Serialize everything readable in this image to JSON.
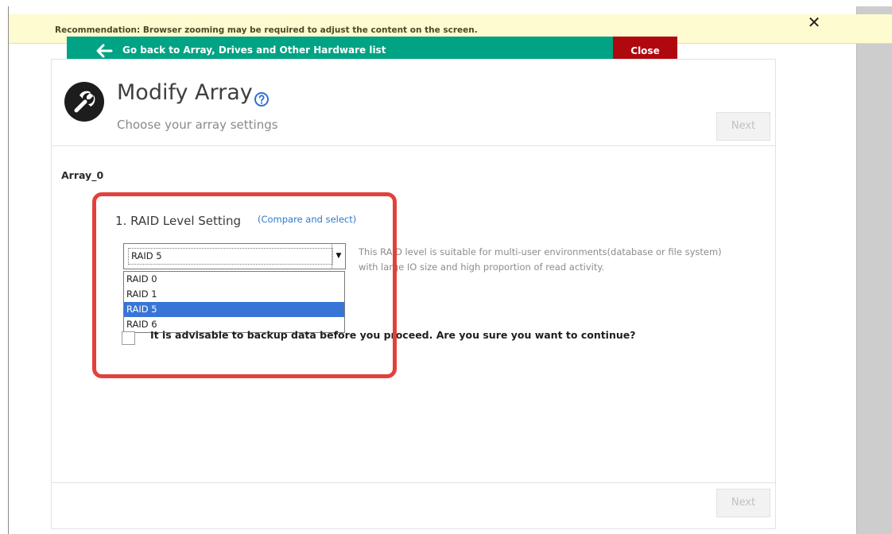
{
  "banner": {
    "text": "Recommendation: Browser zooming may be required to adjust the content on the screen.",
    "close_glyph": "✕"
  },
  "nav": {
    "back_label": "Go back to Array, Drives and Other Hardware list",
    "close_label": "Close"
  },
  "header": {
    "title": "Modify Array",
    "subtitle": "Choose your array settings",
    "next_label": "Next"
  },
  "array": {
    "name": "Array_0"
  },
  "raid": {
    "heading": "1. RAID Level Setting",
    "compare_link": "(Compare and select)",
    "selected_value": "RAID 5",
    "options": [
      "RAID 0",
      "RAID 1",
      "RAID 5",
      "RAID 6"
    ],
    "selected_index": 2,
    "description": "This RAID level is suitable for multi-user environments(database or file system) with large IO size and high proportion of read activity."
  },
  "confirm": {
    "text": "It is advisable to backup data before you proceed. Are you sure you want to continue?",
    "checked": false
  },
  "footer": {
    "next_label": "Next"
  },
  "colors": {
    "banner_bg": "#fffbd0",
    "back_bar": "#00a383",
    "close_bar": "#b0080f",
    "highlight": "#e2413b",
    "link": "#2f79c9",
    "selection": "#3875d7"
  },
  "icons": {
    "back": "arrow-left-icon",
    "close": "close-icon",
    "title": "wrench-icon",
    "help": "help-circle-icon",
    "select": "dropdown-arrow-icon"
  }
}
